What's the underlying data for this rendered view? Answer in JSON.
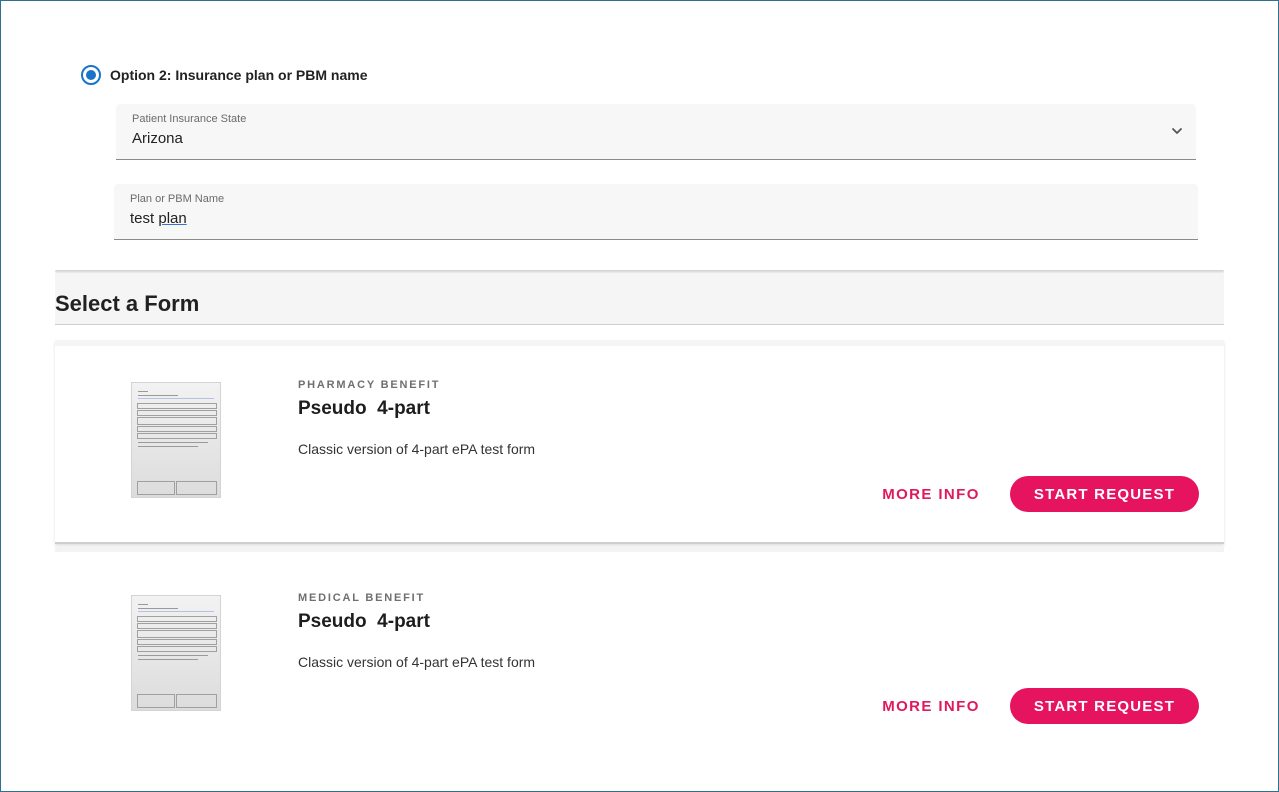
{
  "option": {
    "label": "Option 2: Insurance plan or PBM name",
    "selected": true
  },
  "state_field": {
    "label": "Patient Insurance State",
    "value": "Arizona",
    "icon": "chevron-down-icon"
  },
  "plan_field": {
    "label": "Plan or PBM Name",
    "value_part1": "test ",
    "value_part2": "plan"
  },
  "section": {
    "title": "Select a Form"
  },
  "forms": [
    {
      "benefit": "PHARMACY BENEFIT",
      "name": "Pseudo  4-part",
      "description": "Classic version of 4-part ePA test form",
      "more_info_label": "MORE INFO",
      "start_label": "START REQUEST"
    },
    {
      "benefit": "MEDICAL BENEFIT",
      "name": "Pseudo  4-part",
      "description": "Classic version of 4-part ePA test form",
      "more_info_label": "MORE INFO",
      "start_label": "START REQUEST"
    }
  ],
  "colors": {
    "accent": "#e6135f",
    "radio": "#1a73c8"
  }
}
